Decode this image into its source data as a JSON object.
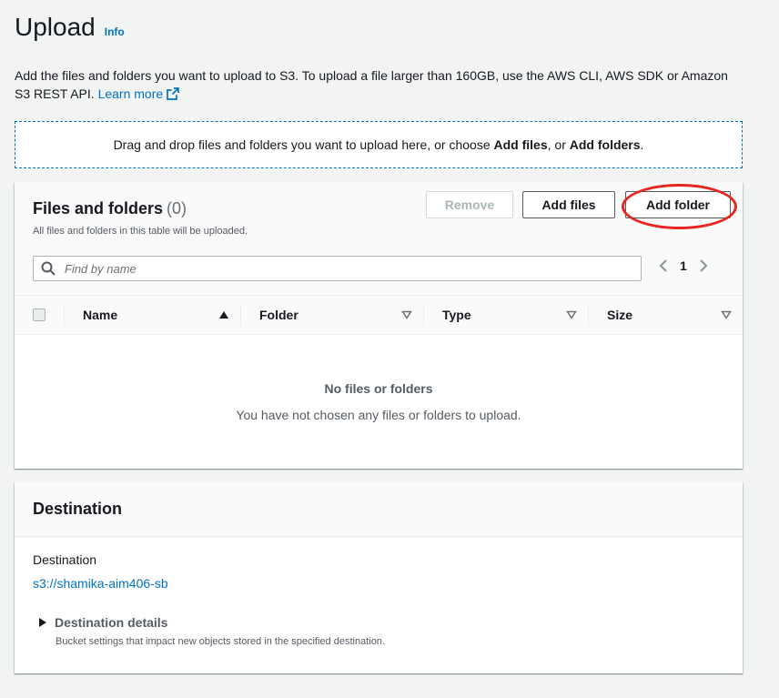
{
  "header": {
    "title": "Upload",
    "info_label": "Info"
  },
  "intro": {
    "text": "Add the files and folders you want to upload to S3. To upload a file larger than 160GB, use the AWS CLI, AWS SDK or Amazon S3 REST API.",
    "learn_more": "Learn more"
  },
  "dropzone": {
    "prefix": "Drag and drop files and folders you want to upload here, or choose ",
    "add_files": "Add files",
    "middle": ", or ",
    "add_folders": "Add folders",
    "suffix": "."
  },
  "files_panel": {
    "title": "Files and folders",
    "count": "(0)",
    "subtitle": "All files and folders in this table will be uploaded.",
    "buttons": {
      "remove": "Remove",
      "add_files": "Add files",
      "add_folder": "Add folder"
    },
    "search": {
      "placeholder": "Find by name",
      "value": ""
    },
    "pagination": {
      "current_page": "1"
    },
    "columns": [
      {
        "label": "Name",
        "sort": "ascending"
      },
      {
        "label": "Folder",
        "sort": "none"
      },
      {
        "label": "Type",
        "sort": "none"
      },
      {
        "label": "Size",
        "sort": "none"
      }
    ],
    "empty": {
      "title": "No files or folders",
      "message": "You have not chosen any files or folders to upload."
    }
  },
  "destination_panel": {
    "title": "Destination",
    "label": "Destination",
    "value": "s3://shamika-aim406-sb",
    "details": {
      "label": "Destination details",
      "description": "Bucket settings that impact new objects stored in the specified destination."
    }
  },
  "colors": {
    "link": "#0073bb",
    "highlight_ring": "#e8251f",
    "background": "#f2f3f3"
  },
  "icons": [
    "external-link-icon",
    "search-icon",
    "chevron-left-icon",
    "chevron-right-icon",
    "sort-ascending-icon",
    "sort-descending-icon",
    "caret-right-icon"
  ]
}
